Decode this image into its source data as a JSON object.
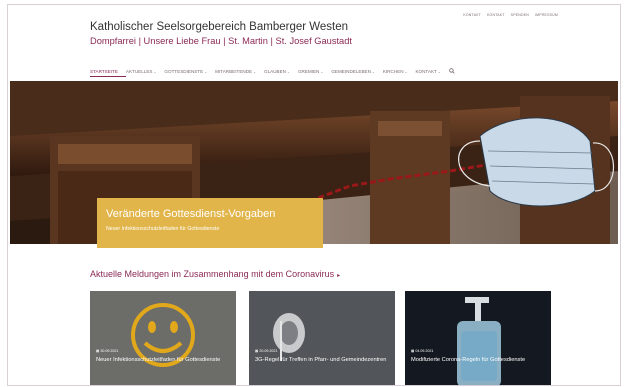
{
  "top_links": [
    "KONTAKT",
    "KONTAKT",
    "SPENDEN",
    "IMPRESSUM"
  ],
  "brand": {
    "title": "Katholischer Seelsorgebereich Bamberger Westen",
    "subtitle": "Dompfarrei | Unsere Liebe Frau | St. Martin | St. Josef Gaustadt"
  },
  "nav": [
    {
      "label": "STARTSEITE",
      "dropdown": false
    },
    {
      "label": "AKTUELLES",
      "dropdown": true
    },
    {
      "label": "GOTTESDIENSTE",
      "dropdown": true
    },
    {
      "label": "MITARBEITENDE",
      "dropdown": true
    },
    {
      "label": "GLAUBEN",
      "dropdown": true
    },
    {
      "label": "GREMIEN",
      "dropdown": true
    },
    {
      "label": "GEMEINDELEBEN",
      "dropdown": true
    },
    {
      "label": "KIRCHEN",
      "dropdown": true
    },
    {
      "label": "KONTAKT",
      "dropdown": true
    }
  ],
  "search_icon": "search-icon",
  "hero": {
    "heading": "Veränderte Gottesdienst-Vorgaben",
    "subheading": "Neuer Infektionsschutzleitfaden für Gottesdienste"
  },
  "section": {
    "heading": "Aktuelle Meldungen im Zusammenhang mit dem Coronavirus",
    "arrow": "▸"
  },
  "cards": [
    {
      "date": "30.09.2021",
      "title": "Neuer Infektionsschutzleitfaden für Gottesdienste"
    },
    {
      "date": "20.09.2021",
      "title": "3G-Regel für Treffen in Pfarr- und Gemeindezentren"
    },
    {
      "date": "04.09.2021",
      "title": "Modifizierte Corona-Regeln für Gottesdienste"
    }
  ],
  "colors": {
    "accent": "#8b2a55",
    "caption_bg": "#e1b54a"
  }
}
